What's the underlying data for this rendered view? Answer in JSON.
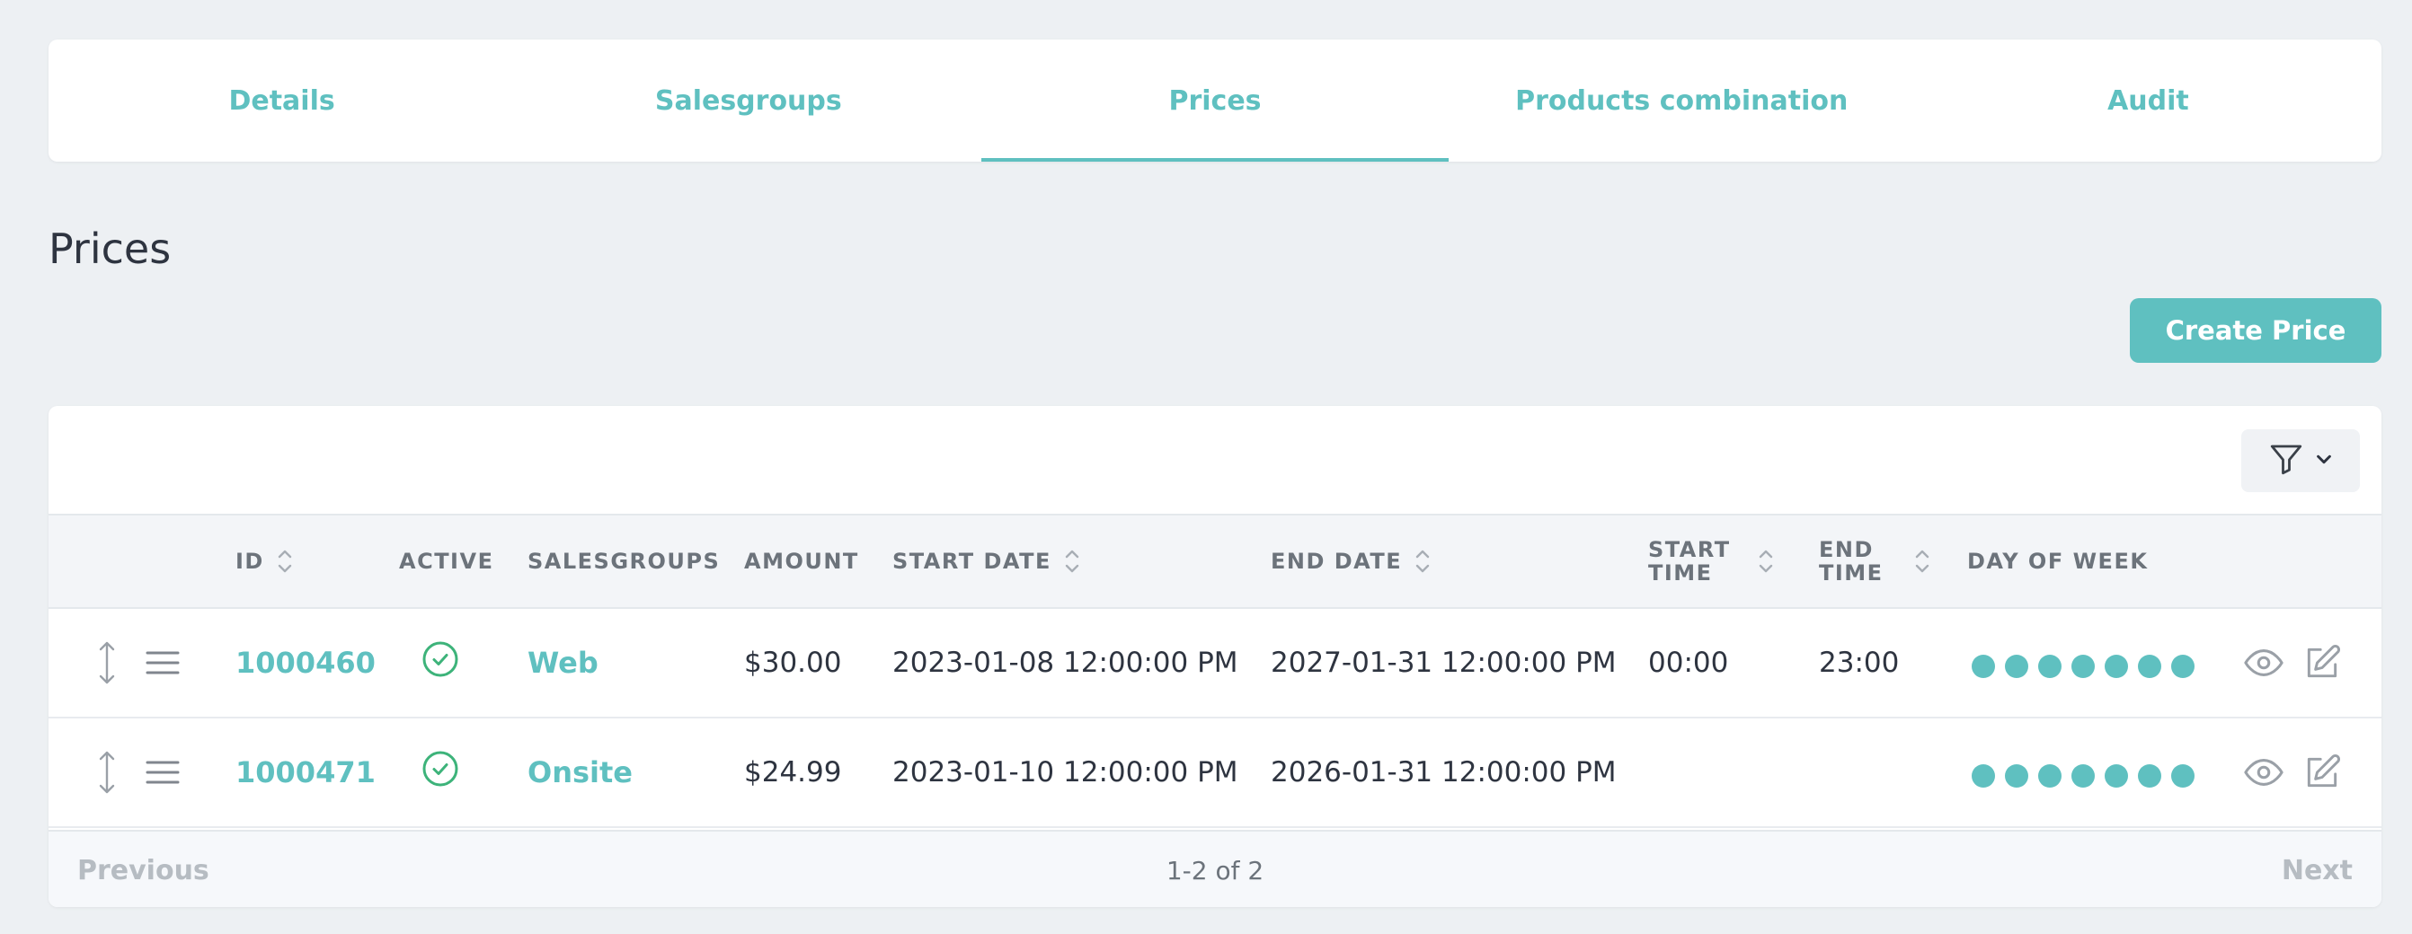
{
  "tabs": [
    {
      "label": "Details"
    },
    {
      "label": "Salesgroups"
    },
    {
      "label": "Prices"
    },
    {
      "label": "Products combination"
    },
    {
      "label": "Audit"
    }
  ],
  "active_tab": "Prices",
  "page_title": "Prices",
  "create_button": "Create Price",
  "filter": {
    "icon": "filter-icon",
    "dropdown_icon": "chevron-down-icon"
  },
  "table": {
    "headers": {
      "id": "ID",
      "active": "ACTIVE",
      "salesgroups": "SALESGROUPS",
      "amount": "AMOUNT",
      "start_date": "START DATE",
      "end_date": "END DATE",
      "start_time_1": "START",
      "start_time_2": "TIME",
      "end_time_1": "END",
      "end_time_2": "TIME",
      "day_of_week": "DAY OF WEEK"
    },
    "rows": [
      {
        "id": "1000460",
        "active": true,
        "salesgroup": "Web",
        "amount": "$30.00",
        "start_date": "2023-01-08 12:00:00 PM",
        "end_date": "2027-01-31 12:00:00 PM",
        "start_time": "00:00",
        "end_time": "23:00",
        "days_active": 7
      },
      {
        "id": "1000471",
        "active": true,
        "salesgroup": "Onsite",
        "amount": "$24.99",
        "start_date": "2023-01-10 12:00:00 PM",
        "end_date": "2026-01-31 12:00:00 PM",
        "start_time": "",
        "end_time": "",
        "days_active": 7
      }
    ]
  },
  "pagination": {
    "previous": "Previous",
    "info": "1-2 of 2",
    "next": "Next"
  },
  "colors": {
    "accent": "#5fc0c0",
    "background": "#edf0f3",
    "active_check": "#3db37a"
  }
}
